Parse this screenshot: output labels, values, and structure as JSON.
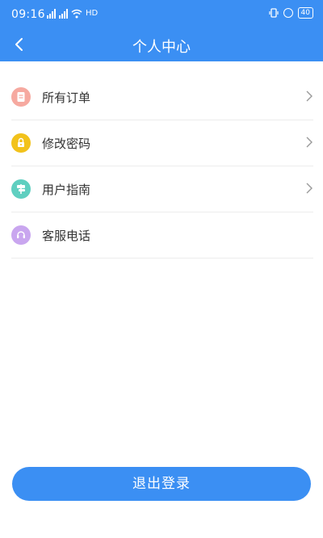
{
  "status_bar": {
    "time": "09:16",
    "net_label": "HD",
    "battery": "40"
  },
  "header": {
    "title": "个人中心"
  },
  "menu": [
    {
      "label": "所有订单",
      "icon": "order-icon",
      "color": "#f6a9a0",
      "has_arrow": true
    },
    {
      "label": "修改密码",
      "icon": "lock-icon",
      "color": "#f2c21b",
      "has_arrow": true
    },
    {
      "label": "用户指南",
      "icon": "signpost-icon",
      "color": "#5fcfc0",
      "has_arrow": true
    },
    {
      "label": "客服电话",
      "icon": "headset-icon",
      "color": "#c9a6ef",
      "has_arrow": false
    }
  ],
  "logout": {
    "label": "退出登录"
  },
  "colors": {
    "primary": "#3b8ff3"
  }
}
